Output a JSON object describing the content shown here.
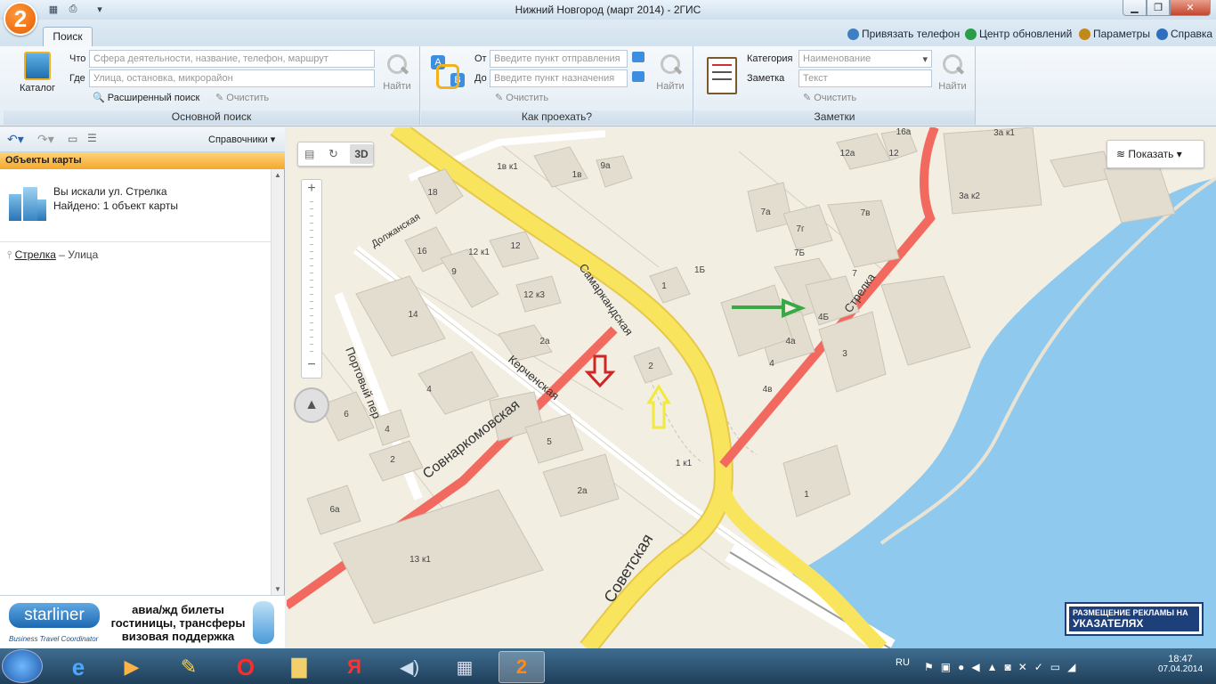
{
  "window": {
    "title": "Нижний Новгород (март 2014) - 2ГИС",
    "logo_text": "2",
    "controls": [
      "minimize-icon",
      "maximize-icon",
      "close-icon"
    ]
  },
  "ribbon": {
    "tabs": [
      {
        "label": "Поиск",
        "active": true
      }
    ],
    "top_links": [
      {
        "label": "Привязать телефон",
        "icon": "phone-link-icon"
      },
      {
        "label": "Центр обновлений",
        "icon": "update-icon"
      },
      {
        "label": "Параметры",
        "icon": "gear-icon"
      },
      {
        "label": "Справка",
        "icon": "help-icon"
      }
    ],
    "main_search": {
      "catalog_label": "Каталог",
      "what_label": "Что",
      "what_placeholder": "Сфера деятельности, название, телефон, маршрут",
      "where_label": "Где",
      "where_placeholder": "Улица, остановка, микрорайон",
      "advanced_label": "Расширенный поиск",
      "clear_label": "Очистить",
      "find_label": "Найти",
      "group_label": "Основной поиск"
    },
    "route": {
      "from_label": "От",
      "from_placeholder": "Введите пункт отправления",
      "to_label": "До",
      "to_placeholder": "Введите пункт назначения",
      "clear_label": "Очистить",
      "find_label": "Найти",
      "group_label": "Как проехать?"
    },
    "notes": {
      "category_label": "Категория",
      "category_placeholder": "Наименование",
      "note_label": "Заметка",
      "note_placeholder": "Текст",
      "clear_label": "Очистить",
      "find_label": "Найти",
      "group_label": "Заметки"
    }
  },
  "left_panel": {
    "directory_label": "Справочники",
    "header": "Объекты карты",
    "search_text": "Вы искали ул. Стрелка",
    "found_text": "Найдено: 1 объект карты",
    "result_name": "Стрелка",
    "result_type": "– Улица"
  },
  "ad": {
    "brand": "starliner",
    "tagline": "Business Travel Coordinator",
    "lines": [
      "авиа/жд билеты",
      "гостиницы, трансферы",
      "визовая поддержка"
    ]
  },
  "map": {
    "show_button": "Показать",
    "view_3d": "3D",
    "ad_banner": [
      "РАЗМЕЩЕНИЕ РЕКЛАМЫ НА",
      "УКАЗАТЕЛЯХ"
    ],
    "street_labels": [
      "Самаркандская",
      "Стрелка",
      "Должанская",
      "Керченская",
      "Совнаркомовская",
      "Портовый пер",
      "Советская"
    ],
    "building_labels": [
      "1в к1",
      "1в",
      "9а",
      "18",
      "16",
      "12 к1",
      "12",
      "9",
      "12 к3",
      "14",
      "2а",
      "4",
      "6",
      "4",
      "2",
      "6а",
      "5",
      "2а",
      "13 к1",
      "1",
      "1Б",
      "2",
      "1 к1",
      "7а",
      "7г",
      "7Б",
      "7в",
      "7",
      "12а",
      "12",
      "16а",
      "3а к1",
      "3а к2",
      "4Б",
      "4а",
      "4",
      "4в",
      "3",
      "1"
    ]
  },
  "taskbar": {
    "language": "RU",
    "time": "18:47",
    "date": "07.04.2014",
    "apps": [
      "start-orb-icon",
      "ie-icon",
      "media-icon",
      "paint-icon",
      "opera-icon",
      "explorer-icon",
      "yandex-icon",
      "volume-app-icon",
      "calculator-icon",
      "2gis-icon"
    ]
  }
}
